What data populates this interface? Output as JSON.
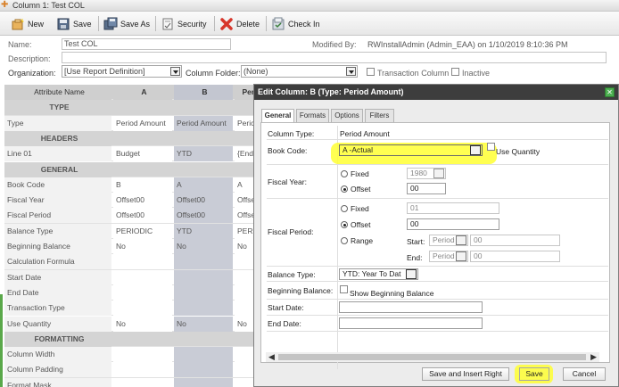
{
  "window": {
    "title": "Column 1: Test COL"
  },
  "toolbar": {
    "new_label": "New",
    "save_label": "Save",
    "save_as_label": "Save As",
    "security_label": "Security",
    "delete_label": "Delete",
    "check_in_label": "Check In"
  },
  "properties": {
    "name_label": "Name:",
    "name_value": "Test COL",
    "description_label": "Description:",
    "description_value": "",
    "organization_label": "Organization:",
    "organization_value": "[Use Report Definition]",
    "column_folder_label": "Column Folder:",
    "column_folder_value": "(None)",
    "transaction_column_label": "Transaction Column",
    "inactive_label": "Inactive",
    "modified_by_label": "Modified By:",
    "modified_by_value": "RWInstallAdmin (Admin_EAA) on 1/10/2019 8:10:36 PM"
  },
  "grid": {
    "headers": [
      "Attribute Name",
      "A",
      "B",
      "Peri"
    ],
    "rows": [
      {
        "type": "section",
        "label": "TYPE"
      },
      {
        "label": "Type",
        "a": "Period Amount",
        "b": "Period Amount",
        "c": "Peric"
      },
      {
        "type": "section",
        "label": "HEADERS"
      },
      {
        "label": "Line 01",
        "a": "Budget",
        "b": "YTD",
        "c": "{End"
      },
      {
        "type": "section",
        "label": "GENERAL"
      },
      {
        "label": "Book Code",
        "a": "B",
        "b": "A",
        "c": "A"
      },
      {
        "label": "Fiscal Year",
        "a": "Offset00",
        "b": "Offset00",
        "c": "Offse"
      },
      {
        "label": "Fiscal Period",
        "a": "Offset00",
        "b": "Offset00",
        "c": "Offse"
      },
      {
        "label": "Balance Type",
        "a": "PERIODIC",
        "b": "YTD",
        "c": "PERI"
      },
      {
        "label": "Beginning Balance",
        "a": "No",
        "b": "No",
        "c": "No"
      },
      {
        "label": "Calculation Formula",
        "a": "",
        "b": "",
        "c": ""
      },
      {
        "label": "Start Date",
        "a": "",
        "b": "",
        "c": ""
      },
      {
        "label": "End Date",
        "a": "",
        "b": "",
        "c": ""
      },
      {
        "label": "Transaction Type",
        "a": "",
        "b": "",
        "c": ""
      },
      {
        "label": "Use Quantity",
        "a": "No",
        "b": "No",
        "c": "No"
      },
      {
        "type": "section",
        "label": "FORMATTING"
      },
      {
        "label": "Column Width",
        "a": "",
        "b": "",
        "c": ""
      },
      {
        "label": "Column Padding",
        "a": "",
        "b": "",
        "c": ""
      },
      {
        "label": "Format Mask",
        "a": "",
        "b": "",
        "c": ""
      }
    ]
  },
  "dialog": {
    "title": "Edit Column: B (Type: Period Amount)",
    "tabs": [
      "General",
      "Formats",
      "Options",
      "Filters"
    ],
    "column_type_label": "Column Type:",
    "column_type_value": "Period Amount",
    "book_code_label": "Book Code:",
    "book_code_value": "A -Actual",
    "use_quantity_label": "Use Quantity",
    "fiscal_year_label": "Fiscal Year:",
    "fixed_label": "Fixed",
    "fiscal_year_fixed_value": "1980",
    "offset_label": "Offset",
    "fiscal_year_offset_value": "00",
    "fiscal_period_label": "Fiscal Period:",
    "fiscal_period_fixed_value": "01",
    "fiscal_period_offset_value": "00",
    "range_label": "Range",
    "start_label": "Start:",
    "end_label": "End:",
    "period_option": "Period",
    "range_start_value": "00",
    "range_end_value": "00",
    "balance_type_label": "Balance Type:",
    "balance_type_value": "YTD: Year To Dat",
    "beginning_balance_label": "Beginning Balance:",
    "show_beginning_balance_label": "Show Beginning Balance",
    "start_date_label": "Start Date:",
    "end_date_label": "End Date:",
    "save_insert_right_label": "Save and Insert Right",
    "save_label": "Save",
    "cancel_label": "Cancel"
  },
  "colors": {
    "dialog_title_bg": "#3d3d3d",
    "highlight": "#ffff33",
    "close_button": "#4caf50",
    "grid_column_b_bg": "#c9ccd6"
  }
}
